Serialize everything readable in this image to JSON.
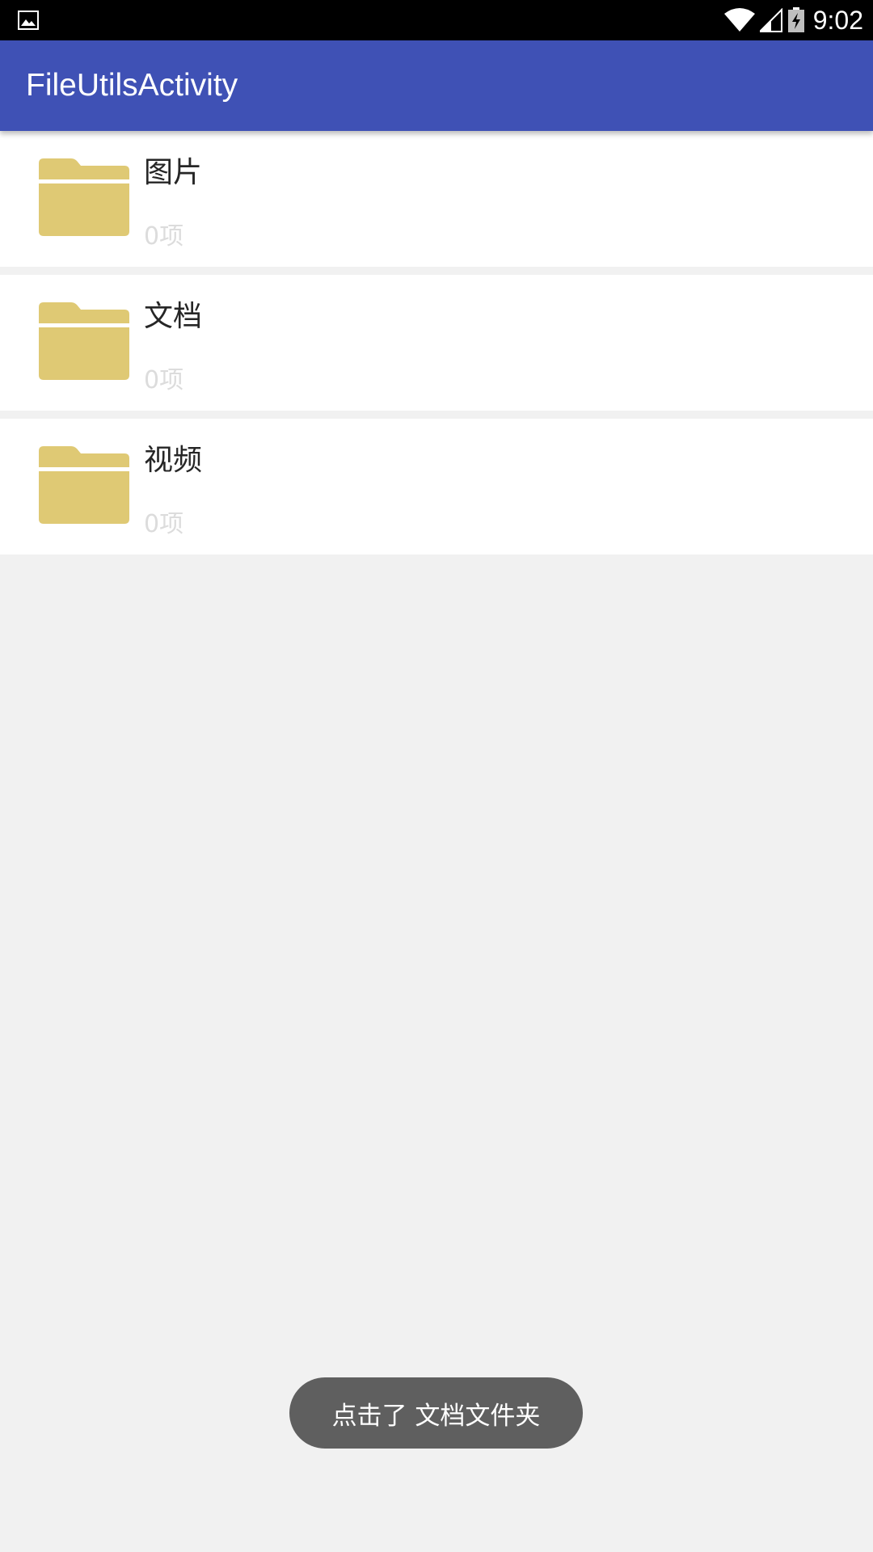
{
  "status_bar": {
    "time": "9:02",
    "icons": [
      "gallery-notification-icon",
      "wifi-icon",
      "cell-signal-icon",
      "battery-charging-icon"
    ]
  },
  "app_bar": {
    "title": "FileUtilsActivity",
    "color": "#3f51b5"
  },
  "folders": [
    {
      "name": "图片",
      "count": "0项"
    },
    {
      "name": "文档",
      "count": "0项"
    },
    {
      "name": "视频",
      "count": "0项"
    }
  ],
  "folder_icon_color": "#dfc974",
  "toast": {
    "message": "点击了 文档文件夹"
  }
}
